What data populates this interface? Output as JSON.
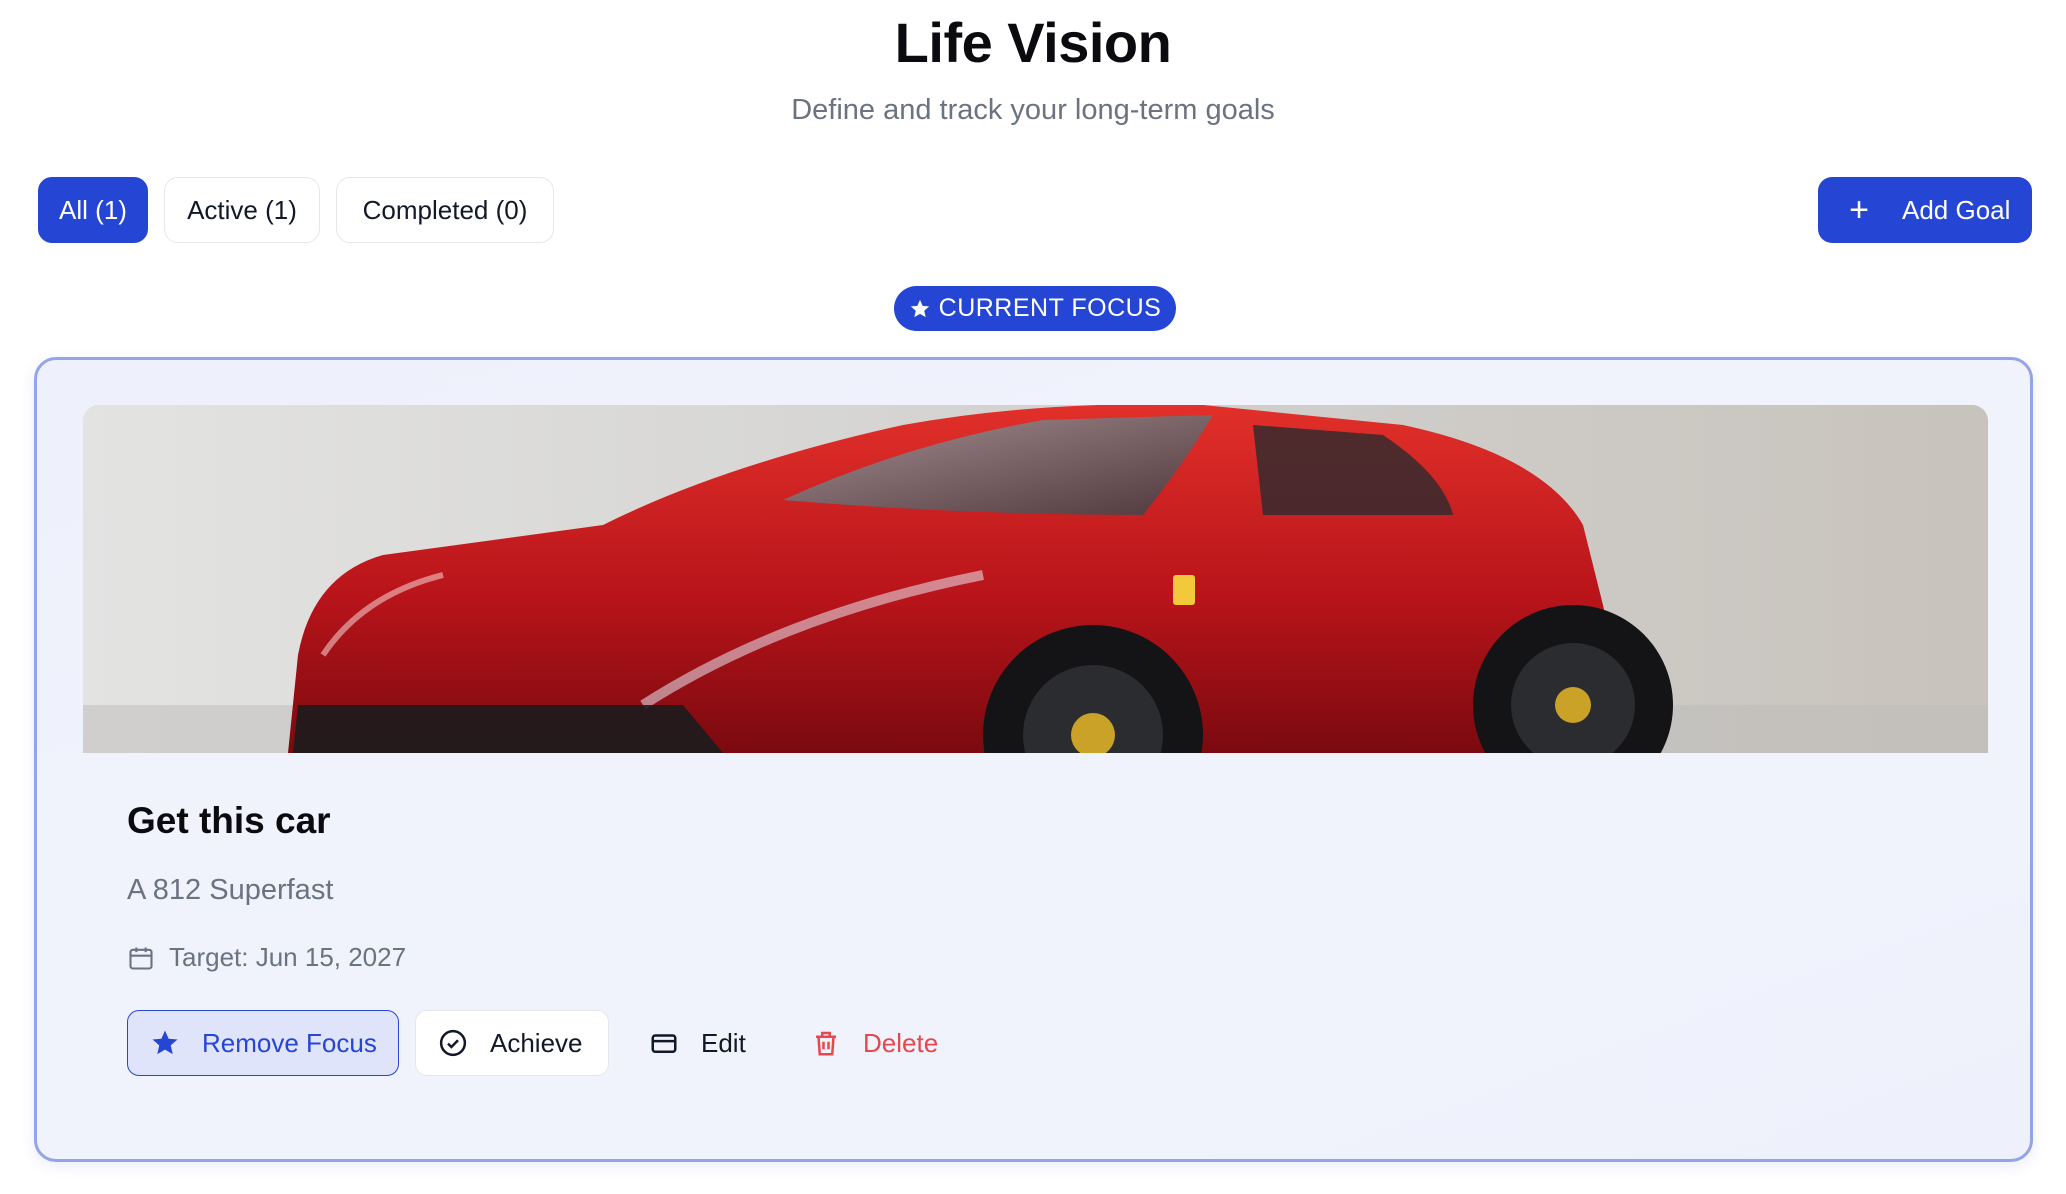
{
  "header": {
    "title": "Life Vision",
    "subtitle": "Define and track your long-term goals"
  },
  "filters": [
    {
      "label": "All (1)",
      "active": true
    },
    {
      "label": "Active (1)",
      "active": false
    },
    {
      "label": "Completed (0)",
      "active": false
    }
  ],
  "add_goal": {
    "label": "Add Goal",
    "icon": "plus-icon"
  },
  "focus_badge": {
    "label": "CURRENT FOCUS",
    "icon": "star-icon"
  },
  "goal": {
    "image_alt": "red-sports-car-photo",
    "title": "Get this car",
    "description": "A 812 Superfast",
    "target": "Target: Jun 15, 2027",
    "actions": {
      "remove_focus": "Remove Focus",
      "achieve": "Achieve",
      "edit": "Edit",
      "delete": "Delete"
    }
  },
  "colors": {
    "accent": "#2546d4",
    "danger": "#e5484d",
    "muted_text": "#6b7280",
    "card_border": "#93a4e8"
  }
}
